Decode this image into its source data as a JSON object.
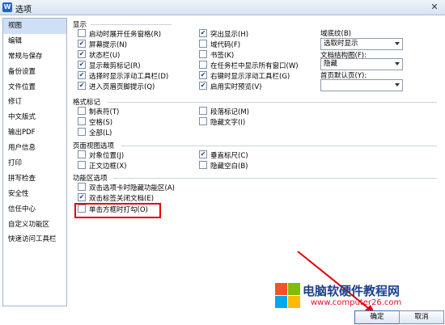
{
  "window": {
    "title": "选项",
    "app_icon_letter": "W",
    "close_glyph": "✕"
  },
  "sidebar": {
    "items": [
      {
        "label": "视图",
        "selected": true
      },
      {
        "label": "编辑"
      },
      {
        "label": "常规与保存"
      },
      {
        "label": "备份设置"
      },
      {
        "label": "文件位置"
      },
      {
        "label": "修订"
      },
      {
        "label": "中文版式"
      },
      {
        "label": "输出PDF"
      },
      {
        "label": "用户信息"
      },
      {
        "label": "打印"
      },
      {
        "label": "拼写检查"
      },
      {
        "label": "安全性"
      },
      {
        "label": "信任中心"
      },
      {
        "label": "自定义功能区"
      },
      {
        "label": "快速访问工具栏"
      }
    ]
  },
  "sections": {
    "display": {
      "title": "显示",
      "left": [
        {
          "label": "启动时展开任务窗格(R)",
          "checked": false
        },
        {
          "label": "屏幕提示(N)",
          "checked": true
        },
        {
          "label": "状态栏(U)",
          "checked": true
        },
        {
          "label": "显示裁剪标记(R)",
          "checked": true
        },
        {
          "label": "选择时显示浮动工具栏(D)",
          "checked": true
        },
        {
          "label": "进入页眉页脚提示(Q)",
          "checked": true
        }
      ],
      "middle": [
        {
          "label": "突出显示(H)",
          "checked": true
        },
        {
          "label": "域代码(F)",
          "checked": false
        },
        {
          "label": "书签(K)",
          "checked": false
        },
        {
          "label": "在任务栏中显示所有窗口(W)",
          "checked": false
        },
        {
          "label": "右键时显示浮动工具栏(G)",
          "checked": true
        },
        {
          "label": "启用实时预览(V)",
          "checked": true
        }
      ],
      "right": {
        "field_shading_label": "域底纹(B)",
        "field_shading_value": "选取时显示",
        "doc_map_label": "文档结构图(F):",
        "doc_map_value": "隐藏",
        "home_page_label": "首页默认页(Y):",
        "home_page_value": ""
      }
    },
    "format_marks": {
      "title": "格式标记",
      "items": [
        {
          "label": "制表符(T)",
          "checked": false
        },
        {
          "label": "段落标记(M)",
          "checked": false
        },
        {
          "label": "空格(S)",
          "checked": false
        },
        {
          "label": "隐藏文字(I)",
          "checked": false
        },
        {
          "label": "全部(L)",
          "checked": false
        }
      ]
    },
    "page_view": {
      "title": "页面视图选项",
      "items": [
        {
          "label": "对象位置(J)",
          "checked": false
        },
        {
          "label": "垂直标尺(C)",
          "checked": true
        },
        {
          "label": "正文边框(X)",
          "checked": false
        },
        {
          "label": "隐藏空白(B)",
          "checked": false
        }
      ]
    },
    "ribbon": {
      "title": "功能区选项",
      "items": [
        {
          "label": "双击选项卡时隐藏功能区(A)",
          "checked": false
        },
        {
          "label": "双击标签关闭文档(E)",
          "checked": true
        },
        {
          "label": "单击方框时打勾(O)",
          "checked": false
        }
      ]
    }
  },
  "buttons": {
    "ok": "确定",
    "cancel": "取消"
  },
  "watermark": {
    "title": "电脑软硬件教程网",
    "url": "www.computer26.com"
  },
  "colors": {
    "highlight": "#e00000",
    "arrow": "#e00000",
    "selected_bg": "#cfe0f6"
  }
}
